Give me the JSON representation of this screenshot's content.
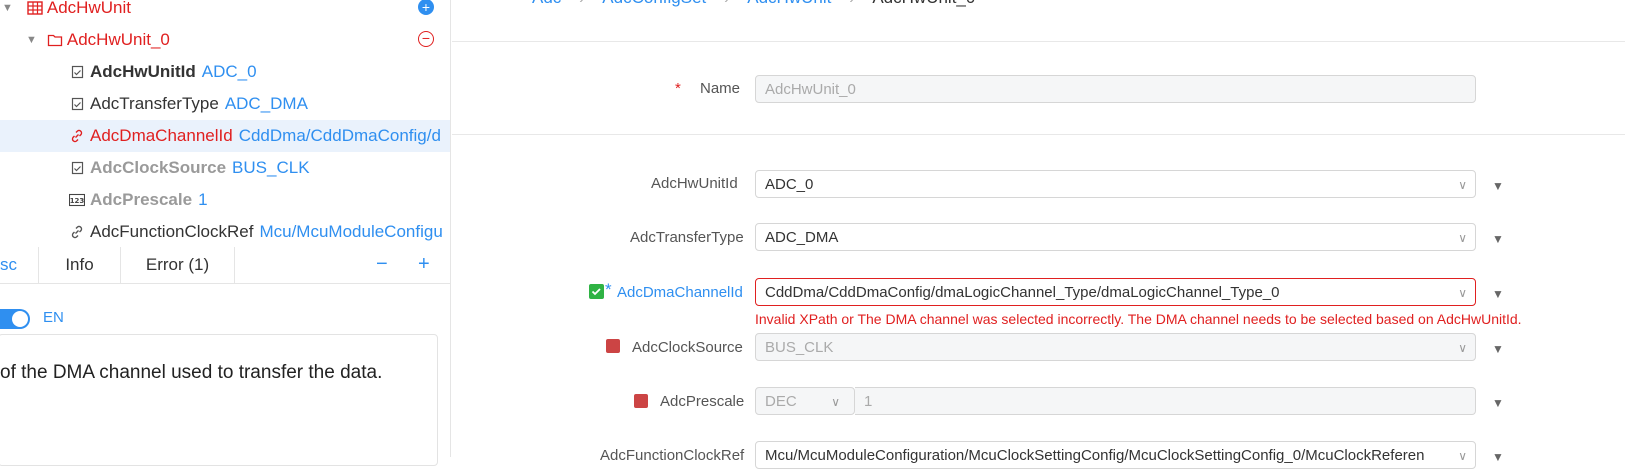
{
  "tree": {
    "root": {
      "name": "AdcHwUnit"
    },
    "unit": {
      "name": "AdcHwUnit_0"
    },
    "items": [
      {
        "name": "AdcHwUnitId",
        "value": "ADC_0"
      },
      {
        "name": "AdcTransferType",
        "value": "ADC_DMA"
      },
      {
        "name": "AdcDmaChannelId",
        "value": "CddDma/CddDmaConfig/d"
      },
      {
        "name": "AdcClockSource",
        "value": "BUS_CLK"
      },
      {
        "name": "AdcPrescale",
        "value": "1"
      },
      {
        "name": "AdcFunctionClockRef",
        "value": "Mcu/McuModuleConfigu"
      }
    ]
  },
  "tabs": [
    {
      "label": "sc"
    },
    {
      "label": "Info"
    },
    {
      "label": "Error (1)"
    }
  ],
  "tab_actions": {
    "minus": "−",
    "plus": "+"
  },
  "desc": {
    "lang": "EN",
    "text": "of the DMA channel used to transfer the data."
  },
  "breadcrumb": [
    "Adc",
    "AdcConfigSet",
    "AdcHwUnit",
    "AdcHwUnit_0"
  ],
  "form": {
    "name": {
      "label": "Name",
      "required": "*",
      "value": "AdcHwUnit_0"
    },
    "hwunitid": {
      "label": "AdcHwUnitId",
      "value": "ADC_0"
    },
    "transfer": {
      "label": "AdcTransferType",
      "value": "ADC_DMA"
    },
    "dma": {
      "label": "AdcDmaChannelId",
      "required": "*",
      "value": "CddDma/CddDmaConfig/dmaLogicChannel_Type/dmaLogicChannel_Type_0",
      "error": "Invalid XPath or The DMA channel was selected incorrectly. The DMA channel needs to be selected based on AdcHwUnitId."
    },
    "clock": {
      "label": "AdcClockSource",
      "value": "BUS_CLK"
    },
    "prescale": {
      "label": "AdcPrescale",
      "mode": "DEC",
      "value": "1"
    },
    "funcclk": {
      "label": "AdcFunctionClockRef",
      "value": "Mcu/McuModuleConfiguration/McuClockSettingConfig/McuClockSettingConfig_0/McuClockReferen"
    }
  },
  "colors": {
    "accent": "#2f8ff0",
    "error": "#e02020",
    "marker": "#c44444",
    "ok": "#2fb344"
  }
}
